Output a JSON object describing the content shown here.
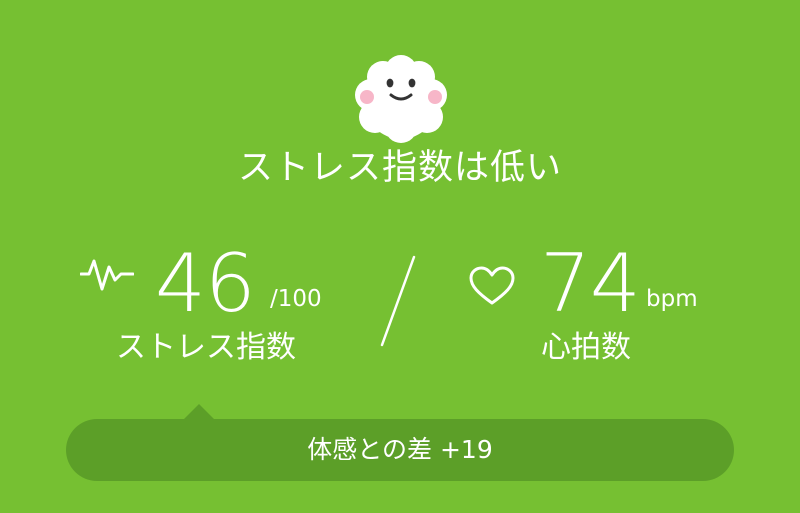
{
  "status": {
    "mascot_icon": "smiling-cloud-mascot-icon",
    "title": "ストレス指数は低い"
  },
  "stress": {
    "icon": "pulse-wave-icon",
    "value": "46",
    "max": "/100",
    "label": "ストレス指数"
  },
  "heart_rate": {
    "icon": "heart-outline-icon",
    "value": "74",
    "unit": "bpm",
    "label": "心拍数"
  },
  "feeling_diff": {
    "text": "体感との差 +19"
  },
  "colors": {
    "background": "#76c032",
    "bubble": "#5c9f28",
    "text": "#ffffff",
    "cheek": "#f7b6c8"
  }
}
